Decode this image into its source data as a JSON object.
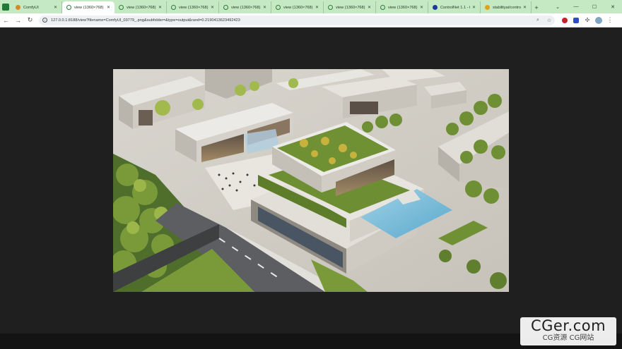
{
  "browser": {
    "tabs": [
      {
        "title": "ComfyUI",
        "icon": "comfyui-favicon",
        "active": false
      },
      {
        "title": "view (1360×768)",
        "icon": "globe-icon",
        "active": true
      },
      {
        "title": "view (1360×768)",
        "icon": "globe-icon",
        "active": false
      },
      {
        "title": "view (1360×768)",
        "icon": "globe-icon",
        "active": false
      },
      {
        "title": "view (1360×768)",
        "icon": "globe-icon",
        "active": false
      },
      {
        "title": "view (1360×768)",
        "icon": "globe-icon",
        "active": false
      },
      {
        "title": "view (1360×768)",
        "icon": "globe-icon",
        "active": false
      },
      {
        "title": "view (1360×768)",
        "icon": "globe-icon",
        "active": false
      },
      {
        "title": "ControlNet 1.1 - t",
        "icon": "controlnet-favicon",
        "active": false
      },
      {
        "title": "stabilityai/contro",
        "icon": "huggingface-favicon",
        "active": false
      }
    ],
    "new_tab_label": "+",
    "window_controls": {
      "dropdown": "⌄",
      "minimize": "—",
      "maximize": "☐",
      "close": "✕"
    },
    "toolbar": {
      "back": "←",
      "forward": "→",
      "reload": "↻",
      "url": "127.0.0.1:8188/view?filename=ComfyUI_03779_.png&subfolder=&type=output&rand=0.2190413623492423",
      "zoom_icon": "⌕",
      "star_icon": "☆",
      "menu_icon": "⋮"
    },
    "colors": {
      "tab_strip": "#c5e9c2",
      "page_background": "#1f1f1f"
    }
  },
  "content": {
    "image_subject": "aerial rendering of modern building complex with green roofs",
    "image_alt": "ComfyUI_03779_.png"
  },
  "watermark": {
    "brand": "CGer.com",
    "subtitle": "CG资源 CG网站"
  }
}
